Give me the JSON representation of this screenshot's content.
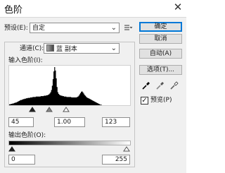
{
  "window": {
    "title": "色阶",
    "close_glyph": "✕"
  },
  "preset": {
    "label": "预设(E):",
    "value": "自定",
    "menu_icon": "preset-options-icon"
  },
  "channel": {
    "label": "通道(C):",
    "value": "蓝 副本"
  },
  "input_levels": {
    "label": "输入色阶(I):",
    "black": "45",
    "gamma": "1.00",
    "white": "123"
  },
  "histogram": {
    "color": "#000000",
    "levels": [
      2,
      2,
      3,
      3,
      4,
      4,
      5,
      6,
      6,
      7,
      8,
      9,
      10,
      11,
      12,
      12,
      13,
      14,
      14,
      15,
      15,
      16,
      16,
      17,
      17,
      17,
      18,
      18,
      18,
      19,
      19,
      19,
      19,
      20,
      20,
      20,
      20,
      20,
      20,
      21,
      21,
      21,
      21,
      22,
      22,
      22,
      23,
      23,
      24,
      25,
      27,
      30,
      35,
      45,
      60,
      78,
      88,
      80,
      62,
      42,
      30,
      26,
      24,
      23,
      22,
      22,
      21,
      21,
      20,
      20,
      20,
      19,
      19,
      19,
      19,
      19,
      19,
      18,
      18,
      18,
      18,
      18,
      18,
      18,
      19,
      20,
      22,
      25,
      28,
      31,
      32,
      30,
      27,
      24,
      22,
      20,
      18,
      17,
      16,
      15,
      14,
      13,
      12,
      11,
      10,
      9,
      8,
      7,
      6,
      5,
      4,
      3,
      2,
      1,
      1,
      0,
      0,
      0,
      0,
      0,
      0,
      0,
      0,
      0,
      0,
      0,
      0,
      0,
      0,
      0,
      0,
      0,
      0,
      0,
      0,
      0,
      0,
      0,
      0,
      0,
      0,
      0,
      0,
      0,
      0,
      0,
      0,
      0,
      0,
      0
    ]
  },
  "output_levels": {
    "label": "输出色阶(O):",
    "black": "0",
    "white": "255"
  },
  "buttons": {
    "ok": "确定",
    "cancel": "取消",
    "auto": "自动(A)",
    "options": "选项(T)..."
  },
  "eyedroppers": [
    "black-point-eyedropper-icon",
    "gray-point-eyedropper-icon",
    "white-point-eyedropper-icon"
  ],
  "preview": {
    "label": "预览(P)",
    "checked": true
  }
}
